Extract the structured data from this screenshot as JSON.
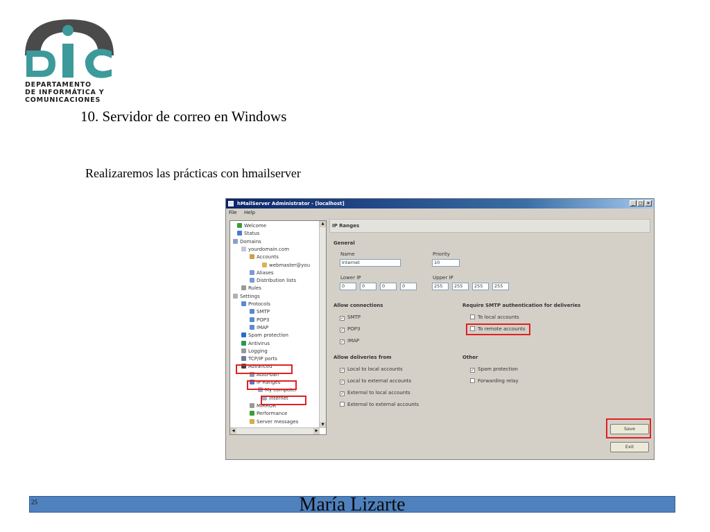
{
  "logo": {
    "line1": "DEPARTAMENTO",
    "line2": "DE INFORMÁTICA Y",
    "line3": "COMUNICACIONES",
    "colors": {
      "teal": "#3d9a9b",
      "gray": "#4a4a4a"
    }
  },
  "slide": {
    "title": "10. Servidor de correo en Windows",
    "subtitle": "Realizaremos las prácticas con hmailserver"
  },
  "window": {
    "title": "hMailServer Administrator - [localhost]",
    "menu": [
      "File",
      "Help"
    ],
    "tree": [
      {
        "label": "Welcome",
        "icon": "welcome-icon"
      },
      {
        "label": "Status",
        "icon": "status-icon"
      },
      {
        "label": "Domains",
        "icon": "domains-icon"
      },
      {
        "label": "yourdomain.com",
        "icon": "domain-icon"
      },
      {
        "label": "Accounts",
        "icon": "accounts-icon"
      },
      {
        "label": "webmaster@you",
        "icon": "account-icon"
      },
      {
        "label": "Aliases",
        "icon": "aliases-icon"
      },
      {
        "label": "Distribution lists",
        "icon": "distribution-icon"
      },
      {
        "label": "Rules",
        "icon": "rules-icon"
      },
      {
        "label": "Settings",
        "icon": "settings-icon"
      },
      {
        "label": "Protocols",
        "icon": "protocols-icon"
      },
      {
        "label": "SMTP",
        "icon": "smtp-icon"
      },
      {
        "label": "POP3",
        "icon": "pop3-icon"
      },
      {
        "label": "IMAP",
        "icon": "imap-icon"
      },
      {
        "label": "Spam protection",
        "icon": "spam-icon"
      },
      {
        "label": "Antivirus",
        "icon": "antivirus-icon"
      },
      {
        "label": "Logging",
        "icon": "logging-icon"
      },
      {
        "label": "TCP/IP ports",
        "icon": "ports-icon"
      },
      {
        "label": "Advanced",
        "icon": "advanced-icon"
      },
      {
        "label": "Auto-ban",
        "icon": "autoban-icon"
      },
      {
        "label": "IP Ranges",
        "icon": "ipranges-icon"
      },
      {
        "label": "My computer",
        "icon": "computer-icon"
      },
      {
        "label": "Internet",
        "icon": "internet-icon"
      },
      {
        "label": "MIRROR",
        "icon": "mirror-icon"
      },
      {
        "label": "Performance",
        "icon": "performance-icon"
      },
      {
        "label": "Server messages",
        "icon": "messages-icon"
      }
    ],
    "panel": {
      "title": "IP Ranges",
      "general": {
        "heading": "General",
        "name_label": "Name",
        "name_value": "Internet",
        "priority_label": "Priority",
        "priority_value": "10",
        "lower_ip_label": "Lower IP",
        "lower_ip": [
          "0",
          "0",
          "0",
          "0"
        ],
        "upper_ip_label": "Upper IP",
        "upper_ip": [
          "255",
          "255",
          "255",
          "255"
        ]
      },
      "allow_connections": {
        "heading": "Allow connections",
        "items": [
          {
            "label": "SMTP",
            "checked": true
          },
          {
            "label": "POP3",
            "checked": true
          },
          {
            "label": "IMAP",
            "checked": true
          }
        ]
      },
      "require_auth": {
        "heading": "Require SMTP authentication for deliveries",
        "items": [
          {
            "label": "To local accounts",
            "checked": false
          },
          {
            "label": "To remote accounts",
            "checked": false
          }
        ]
      },
      "allow_deliveries": {
        "heading": "Allow deliveries from",
        "items": [
          {
            "label": "Local to local accounts",
            "checked": true
          },
          {
            "label": "Local to external accounts",
            "checked": true
          },
          {
            "label": "External to local accounts",
            "checked": true
          },
          {
            "label": "External to external accounts",
            "checked": false
          }
        ]
      },
      "other": {
        "heading": "Other",
        "items": [
          {
            "label": "Spam protection",
            "checked": true
          },
          {
            "label": "Forwarding relay",
            "checked": false
          }
        ]
      },
      "save_label": "Save",
      "exit_label": "Exit"
    }
  },
  "footer": {
    "page_number": "25",
    "author": "María Lizarte",
    "color": "#4f81bd"
  }
}
